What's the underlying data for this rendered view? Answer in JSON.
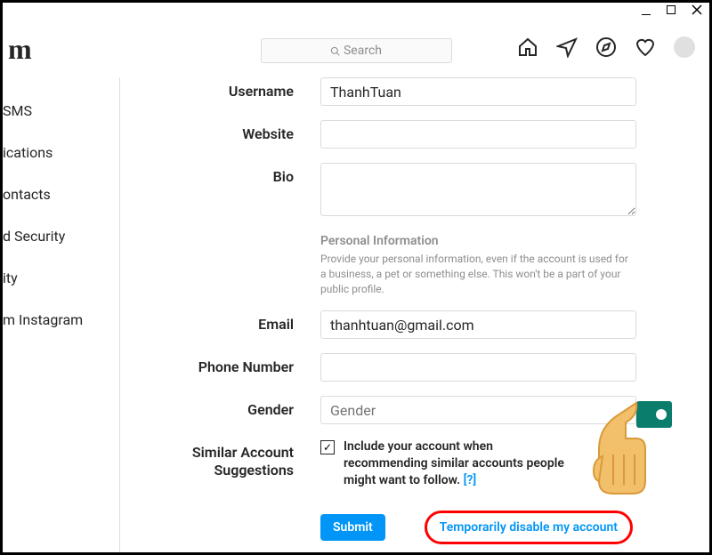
{
  "logo_fragment": "m",
  "search": {
    "placeholder": "Search"
  },
  "sidebar": {
    "items": [
      {
        "label": "SMS"
      },
      {
        "label": "ications"
      },
      {
        "label": "ontacts"
      },
      {
        "label": "d Security"
      },
      {
        "label": "ity"
      },
      {
        "label": "m Instagram"
      }
    ]
  },
  "form": {
    "username": {
      "label": "Username",
      "value": "ThanhTuan"
    },
    "website": {
      "label": "Website",
      "value": ""
    },
    "bio": {
      "label": "Bio",
      "value": ""
    },
    "personal_heading": "Personal Information",
    "personal_desc": "Provide your personal information, even if the account is used for a business, a pet or something else. This won't be a part of your public profile.",
    "email": {
      "label": "Email",
      "value": "thanhtuan@gmail.com"
    },
    "phone": {
      "label": "Phone Number",
      "value": ""
    },
    "gender": {
      "label": "Gender",
      "placeholder": "Gender",
      "value": ""
    },
    "similar": {
      "label_line1": "Similar Account",
      "label_line2": "Suggestions",
      "checked": true,
      "text": "Include your account when recommending similar accounts people might want to follow.",
      "help": "[?]"
    },
    "submit_label": "Submit",
    "disable_link": "Temporarily disable my account"
  }
}
